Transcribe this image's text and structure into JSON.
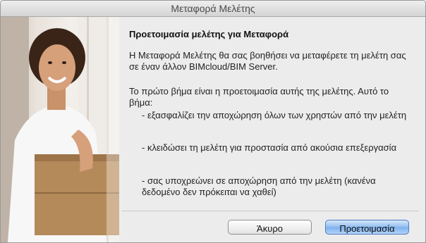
{
  "window": {
    "title": "Μεταφορά Μελέτης"
  },
  "content": {
    "heading": "Προετοιμασία μελέτης για Μεταφορά",
    "paragraph1": "Η Μεταφορά Μελέτης θα σας βοηθήσει να μεταφέρετε τη μελέτη σας σε έναν άλλον BIMcloud/BIM Server.",
    "paragraph2": "Το πρώτο βήμα είναι η προετοιμασία αυτής της μελέτης. Αυτό το βήμα:",
    "bullets": [
      "- εξασφαλίζει την αποχώρηση όλων των χρηστών από την μελέτη",
      "- κλειδώσει τη μελέτη για προστασία από ακούσια επεξεργασία",
      "- σας υποχρεώνει σε αποχώρηση από την μελέτη (κανένα δεδομένο δεν πρόκειται να χαθεί)"
    ]
  },
  "buttons": {
    "cancel": "Άκυρο",
    "prepare": "Προετοιμασία"
  },
  "colors": {
    "default_button": "#7cb0ee",
    "window_bg": "#ececec"
  }
}
